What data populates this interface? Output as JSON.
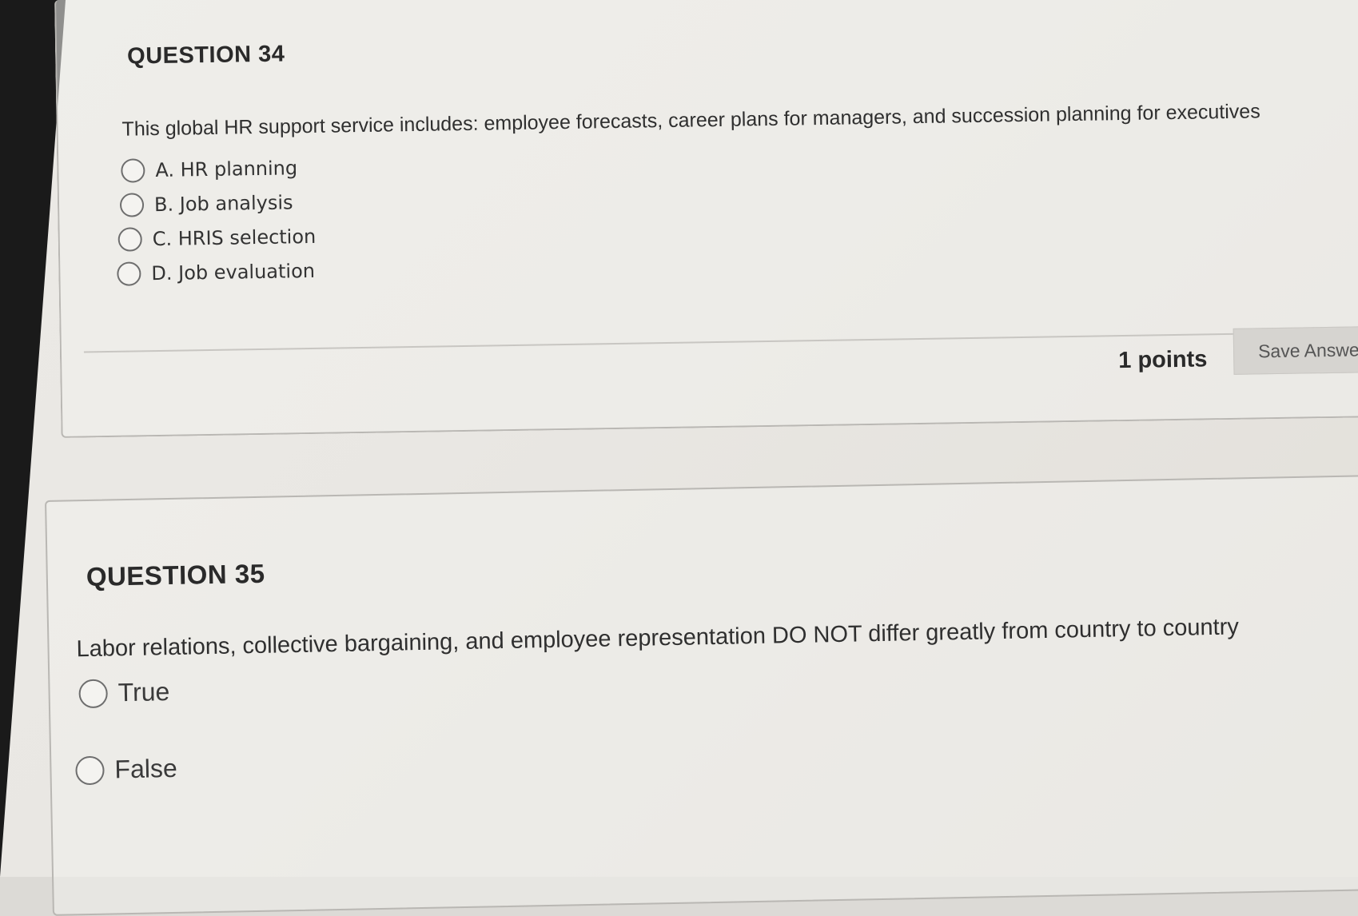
{
  "question34": {
    "heading": "QUESTION 34",
    "text": "This global HR support service includes: employee forecasts, career plans for managers, and succession planning for executives",
    "choices": [
      {
        "label": "A. HR planning"
      },
      {
        "label": "B. Job analysis"
      },
      {
        "label": "C. HRIS selection"
      },
      {
        "label": "D. Job evaluation"
      }
    ],
    "points": "1 points",
    "save_label": "Save Answe"
  },
  "question35": {
    "heading": "QUESTION 35",
    "text": "Labor relations, collective bargaining, and employee representation DO NOT differ greatly from country to country",
    "choices": [
      {
        "label": "True"
      },
      {
        "label": "False"
      }
    ]
  },
  "icons": {
    "radio": "radio-unselected-icon"
  },
  "colors": {
    "page_background": "#e9e7e3",
    "card_border": "#b9b7b3",
    "button_background": "#d6d4d0",
    "bezel": "#1a1a1a"
  }
}
